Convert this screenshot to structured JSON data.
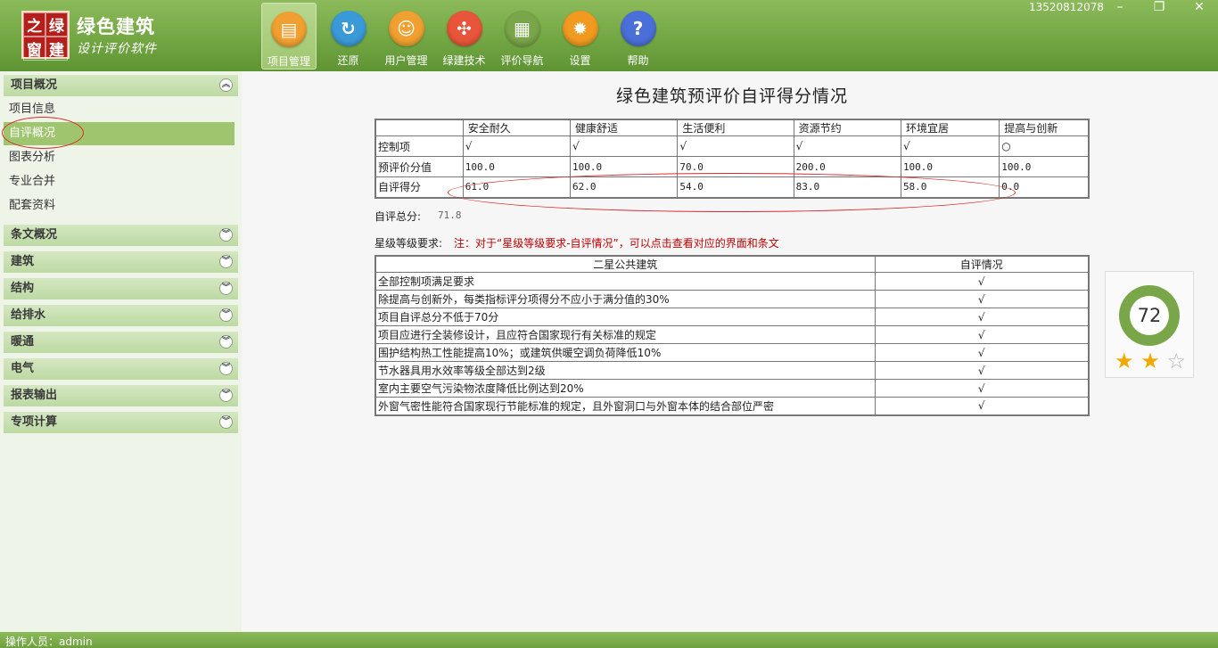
{
  "header": {
    "logo_chars": [
      "之",
      "绿",
      "窗",
      "建"
    ],
    "app_title": "绿色建筑",
    "app_subtitle": "设计评价软件",
    "toolbar": [
      {
        "label": "项目管理",
        "icon": "folder-icon",
        "color": "#f0a030",
        "glyph": "▤"
      },
      {
        "label": "还原",
        "icon": "refresh-icon",
        "color": "#3a9ad8",
        "glyph": "↻"
      },
      {
        "label": "用户管理",
        "icon": "users-icon",
        "color": "#f0a030",
        "glyph": "☺"
      },
      {
        "label": "绿建技术",
        "icon": "network-icon",
        "color": "#e8553a",
        "glyph": "✣"
      },
      {
        "label": "评价导航",
        "icon": "book-icon",
        "color": "#7aa64a",
        "glyph": "▦"
      },
      {
        "label": "设置",
        "icon": "gear-icon",
        "color": "#f09a20",
        "glyph": "✹"
      },
      {
        "label": "帮助",
        "icon": "help-icon",
        "color": "#4a6fd8",
        "glyph": "?"
      }
    ],
    "user_phone": "13520812078",
    "window_controls": {
      "minimize": "–",
      "restore": "❐",
      "close": "✕"
    }
  },
  "sidebar": {
    "sections": [
      {
        "label": "项目概况",
        "toggle": "︽",
        "items": [
          "项目信息",
          "自评概况",
          "图表分析",
          "专业合并",
          "配套资料"
        ]
      },
      {
        "label": "条文概况",
        "toggle": "︾"
      },
      {
        "label": "建筑",
        "toggle": "︾"
      },
      {
        "label": "结构",
        "toggle": "︾"
      },
      {
        "label": "给排水",
        "toggle": "︾"
      },
      {
        "label": "暖通",
        "toggle": "︾"
      },
      {
        "label": "电气",
        "toggle": "︾"
      },
      {
        "label": "报表输出",
        "toggle": "︾"
      },
      {
        "label": "专项计算",
        "toggle": "︾"
      }
    ],
    "active_item": "自评概况"
  },
  "main": {
    "title": "绿色建筑预评价自评得分情况",
    "score_table": {
      "columns": [
        "",
        "安全耐久",
        "健康舒适",
        "生活便利",
        "资源节约",
        "环境宜居",
        "提高与创新"
      ],
      "rows": [
        {
          "label": "控制项",
          "cells": [
            "√",
            "√",
            "√",
            "√",
            "√",
            "○"
          ]
        },
        {
          "label": "预评价分值",
          "cells": [
            "100.0",
            "100.0",
            "70.0",
            "200.0",
            "100.0",
            "100.0"
          ]
        },
        {
          "label": "自评得分",
          "cells": [
            "61.0",
            "62.0",
            "54.0",
            "83.0",
            "58.0",
            "0.0"
          ]
        }
      ]
    },
    "total_label": "自评总分:",
    "total_value": "71.8",
    "requirement_label": "星级等级要求:",
    "requirement_note": "注：对于“星级等级要求-自评情况”，可以点击查看对应的界面和条文",
    "requirement_table": {
      "columns": [
        "二星公共建筑",
        "自评情况"
      ],
      "rows": [
        [
          "全部控制项满足要求",
          "√"
        ],
        [
          "除提高与创新外，每类指标评分项得分不应小于满分值的30%",
          "√"
        ],
        [
          "项目自评总分不低于70分",
          "√"
        ],
        [
          "项目应进行全装修设计，且应符合国家现行有关标准的规定",
          "√"
        ],
        [
          "围护结构热工性能提高10%；或建筑供暖空调负荷降低10%",
          "√"
        ],
        [
          "节水器具用水效率等级全部达到2级",
          "√"
        ],
        [
          "室内主要空气污染物浓度降低比例达到20%",
          "√"
        ],
        [
          "外窗气密性能符合国家现行节能标准的规定，且外窗洞口与外窗本体的结合部位严密",
          "√"
        ]
      ]
    },
    "badge": {
      "score": "72",
      "stars_filled": 2,
      "stars_total": 3,
      "star_glyph": "★",
      "star_empty_glyph": "☆",
      "ring_color": "#7aa64a"
    }
  },
  "status": {
    "operator": "操作人员：admin"
  }
}
